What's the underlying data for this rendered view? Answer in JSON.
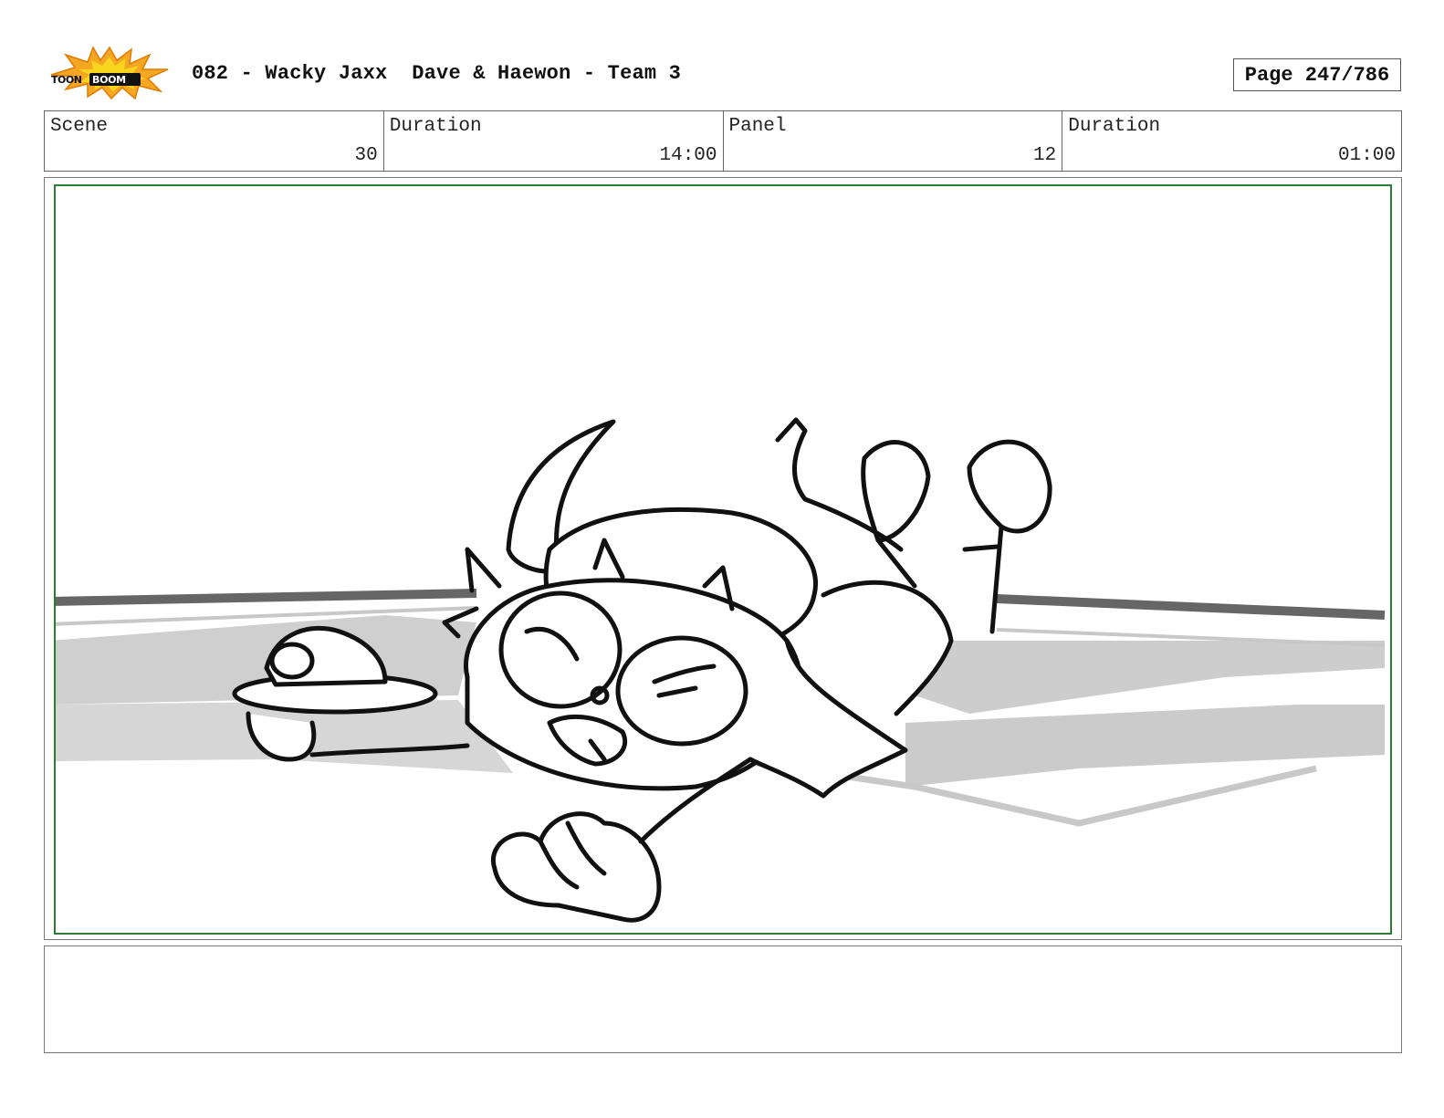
{
  "header": {
    "logo": {
      "icon": "toon-boom-logo-icon",
      "text": "TOON BOOM",
      "colors": {
        "burst": "#f5a623",
        "burst_inner": "#f7d51d",
        "text": "#111111"
      }
    },
    "title": "082 - Wacky Jaxx  Dave & Haewon - Team 3",
    "page": "Page 247/786"
  },
  "info": {
    "scene_label": "Scene",
    "scene_value": "30",
    "scene_duration_label": "Duration",
    "scene_duration_value": "14:00",
    "panel_label": "Panel",
    "panel_value": "12",
    "panel_duration_label": "Duration",
    "panel_duration_value": "01:00"
  },
  "panel": {
    "description": "",
    "frame_color": "#2e7d32"
  },
  "notes": {
    "text": ""
  }
}
